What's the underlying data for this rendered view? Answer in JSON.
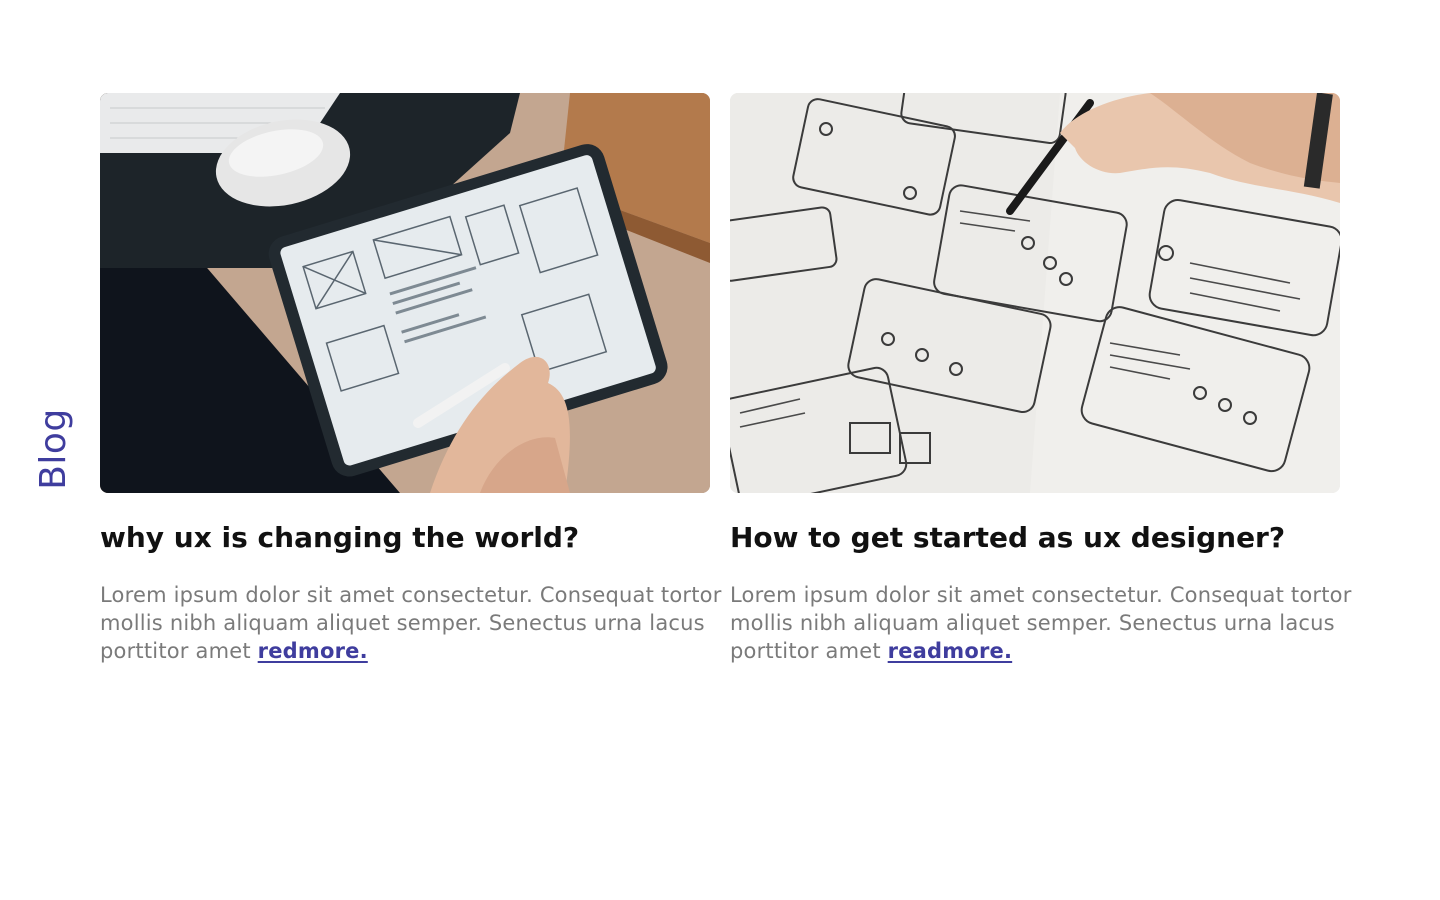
{
  "sidebar": {
    "label": "Blog"
  },
  "colors": {
    "accent": "#3f3d9e",
    "title": "#111111",
    "body": "#7a7a7a"
  },
  "posts": [
    {
      "title": "why ux is changing the world?",
      "excerpt": "Lorem ipsum dolor sit amet consectetur. Consequat tortor mollis nibh aliquam aliquet semper. Senectus urna lacus porttitor amet ",
      "link_label": "redmore.",
      "image": "tablet-wireframe-photo"
    },
    {
      "title": "How to get started as ux designer?",
      "excerpt": "Lorem ipsum dolor sit amet consectetur. Consequat tortor mollis nibh aliquam aliquet semper. Senectus urna lacus porttitor amet ",
      "link_label": "readmore.",
      "image": "paper-sketches-photo"
    }
  ]
}
